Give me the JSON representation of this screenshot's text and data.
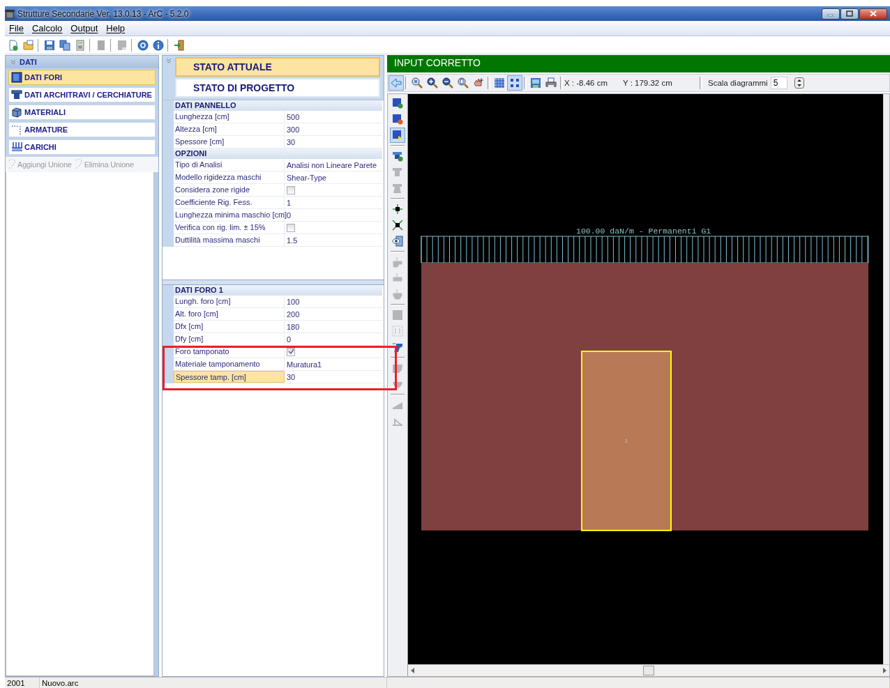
{
  "window": {
    "title": "Strutture Secondarie Ver. 13.0.13 - ArC - 5.2.0"
  },
  "menu": [
    {
      "label": "File"
    },
    {
      "label": "Calcolo"
    },
    {
      "label": "Output"
    },
    {
      "label": "Help"
    }
  ],
  "toolbar": [
    [
      {
        "disabled": false
      },
      {
        "disabled": false
      }
    ],
    [
      {
        "disabled": false
      },
      {
        "disabled": false
      },
      {
        "disabled": false
      }
    ],
    [
      {
        "disabled": true
      }
    ],
    [
      {
        "disabled": true
      }
    ],
    [
      {
        "disabled": false
      },
      {
        "disabled": false
      }
    ],
    [
      {
        "disabled": false
      }
    ]
  ],
  "sidebar": {
    "title": "DATI",
    "expanded": true,
    "items": [
      {
        "label": "DATI FORI",
        "selected": true
      },
      {
        "label": "DATI ARCHITRAVI / CERCHIATURE",
        "selected": false
      },
      {
        "label": "MATERIALI",
        "selected": false
      },
      {
        "label": "ARMATURE",
        "selected": false
      },
      {
        "label": "CARICHI",
        "selected": false
      }
    ],
    "actions": [
      {
        "label": "Aggiungi Unione",
        "disabled": true
      },
      {
        "label": "Elimina Unione",
        "disabled": true
      }
    ]
  },
  "states": {
    "expanded": true,
    "items": [
      {
        "label": "STATO ATTUALE",
        "selected": true
      },
      {
        "label": "STATO DI PROGETTO",
        "selected": false
      }
    ]
  },
  "upper_grid": [
    {
      "title": "DATI PANNELLO",
      "rows": [
        {
          "label": "Lunghezza [cm]",
          "kind": "text",
          "value": "500",
          "selected": false
        },
        {
          "label": "Altezza [cm]",
          "kind": "text",
          "value": "300",
          "selected": false
        },
        {
          "label": "Spessore [cm]",
          "kind": "text",
          "value": "30",
          "selected": false
        }
      ]
    },
    {
      "title": "OPZIONI",
      "rows": [
        {
          "label": "Tipo di Analisi",
          "kind": "text",
          "value": "Analisi non Lineare Parete",
          "selected": false
        },
        {
          "label": "Modello rigidezza maschi",
          "kind": "text",
          "value": "Shear-Type",
          "selected": false
        },
        {
          "label": "Considera zone rigide",
          "kind": "checkbox",
          "checked": false,
          "selected": false
        },
        {
          "label": "Coefficiente Rig. Fess.",
          "kind": "text",
          "value": "1",
          "selected": false
        },
        {
          "label": "Lunghezza minima maschio [cm]",
          "kind": "text",
          "value": "0",
          "selected": false
        },
        {
          "label": "Verifica con rig. lim. ± 15%",
          "kind": "checkbox",
          "checked": false,
          "selected": false
        },
        {
          "label": "Duttilità massima maschi",
          "kind": "text",
          "value": "1.5",
          "selected": false
        }
      ]
    }
  ],
  "lower_grid": [
    {
      "title": "DATI FORO 1",
      "rows": [
        {
          "label": "Lungh. foro [cm]",
          "kind": "text",
          "value": "100",
          "selected": false
        },
        {
          "label": "Alt. foro [cm]",
          "kind": "text",
          "value": "200",
          "selected": false
        },
        {
          "label": "Dfx [cm]",
          "kind": "text",
          "value": "180",
          "selected": false
        },
        {
          "label": "Dfy [cm]",
          "kind": "text",
          "value": "0",
          "selected": false
        },
        {
          "label": "Foro tamponato",
          "kind": "checkbox",
          "checked": true,
          "selected": false
        },
        {
          "label": "Materiale tamponamento",
          "kind": "text",
          "value": "Muratura1",
          "selected": false
        },
        {
          "label": "Spessore tamp. [cm]",
          "kind": "text",
          "value": "30",
          "selected": true
        }
      ]
    }
  ],
  "status_banner": {
    "text": "INPUT CORRETTO",
    "ok": true
  },
  "canvas_toolbar": {
    "groups": [
      [
        {
          "selected": true
        }
      ],
      [
        {
          "selected": false
        },
        {
          "selected": false
        },
        {
          "selected": false
        },
        {
          "selected": false
        },
        {
          "selected": false
        }
      ],
      [
        {
          "selected": false
        },
        {
          "selected": true
        }
      ],
      [
        {
          "selected": false
        },
        {
          "selected": false
        }
      ]
    ],
    "x_reading": "X : -8.46 cm",
    "y_reading": "Y : 179.32 cm",
    "scale_label": "Scala diagrammi",
    "scale_value": "5"
  },
  "side_toolbar": [
    [
      {
        "disabled": false,
        "selected": false
      },
      {
        "disabled": false,
        "selected": false
      },
      {
        "disabled": false,
        "selected": true
      }
    ],
    [
      {
        "disabled": false,
        "selected": false
      },
      {
        "disabled": true,
        "selected": false
      },
      {
        "disabled": true,
        "selected": false
      }
    ],
    [
      {
        "disabled": false,
        "selected": false
      },
      {
        "disabled": false,
        "selected": false
      },
      {
        "disabled": false,
        "selected": false
      }
    ],
    [
      {
        "disabled": true,
        "selected": false
      },
      {
        "disabled": true,
        "selected": false
      },
      {
        "disabled": true,
        "selected": false
      }
    ],
    [
      {
        "disabled": true,
        "selected": false
      },
      {
        "disabled": true,
        "selected": false
      },
      {
        "disabled": false,
        "selected": false
      }
    ],
    [
      {
        "disabled": true,
        "selected": false
      },
      {
        "disabled": true,
        "selected": false
      }
    ],
    [
      {
        "disabled": true,
        "selected": false
      },
      {
        "disabled": true,
        "selected": false
      }
    ]
  ],
  "canvas": {
    "load_label": "100.00 daN/m - Permanenti G1",
    "opening_label": "1"
  },
  "status_bar": {
    "code": "2001",
    "file": "Nuovo.arc"
  }
}
